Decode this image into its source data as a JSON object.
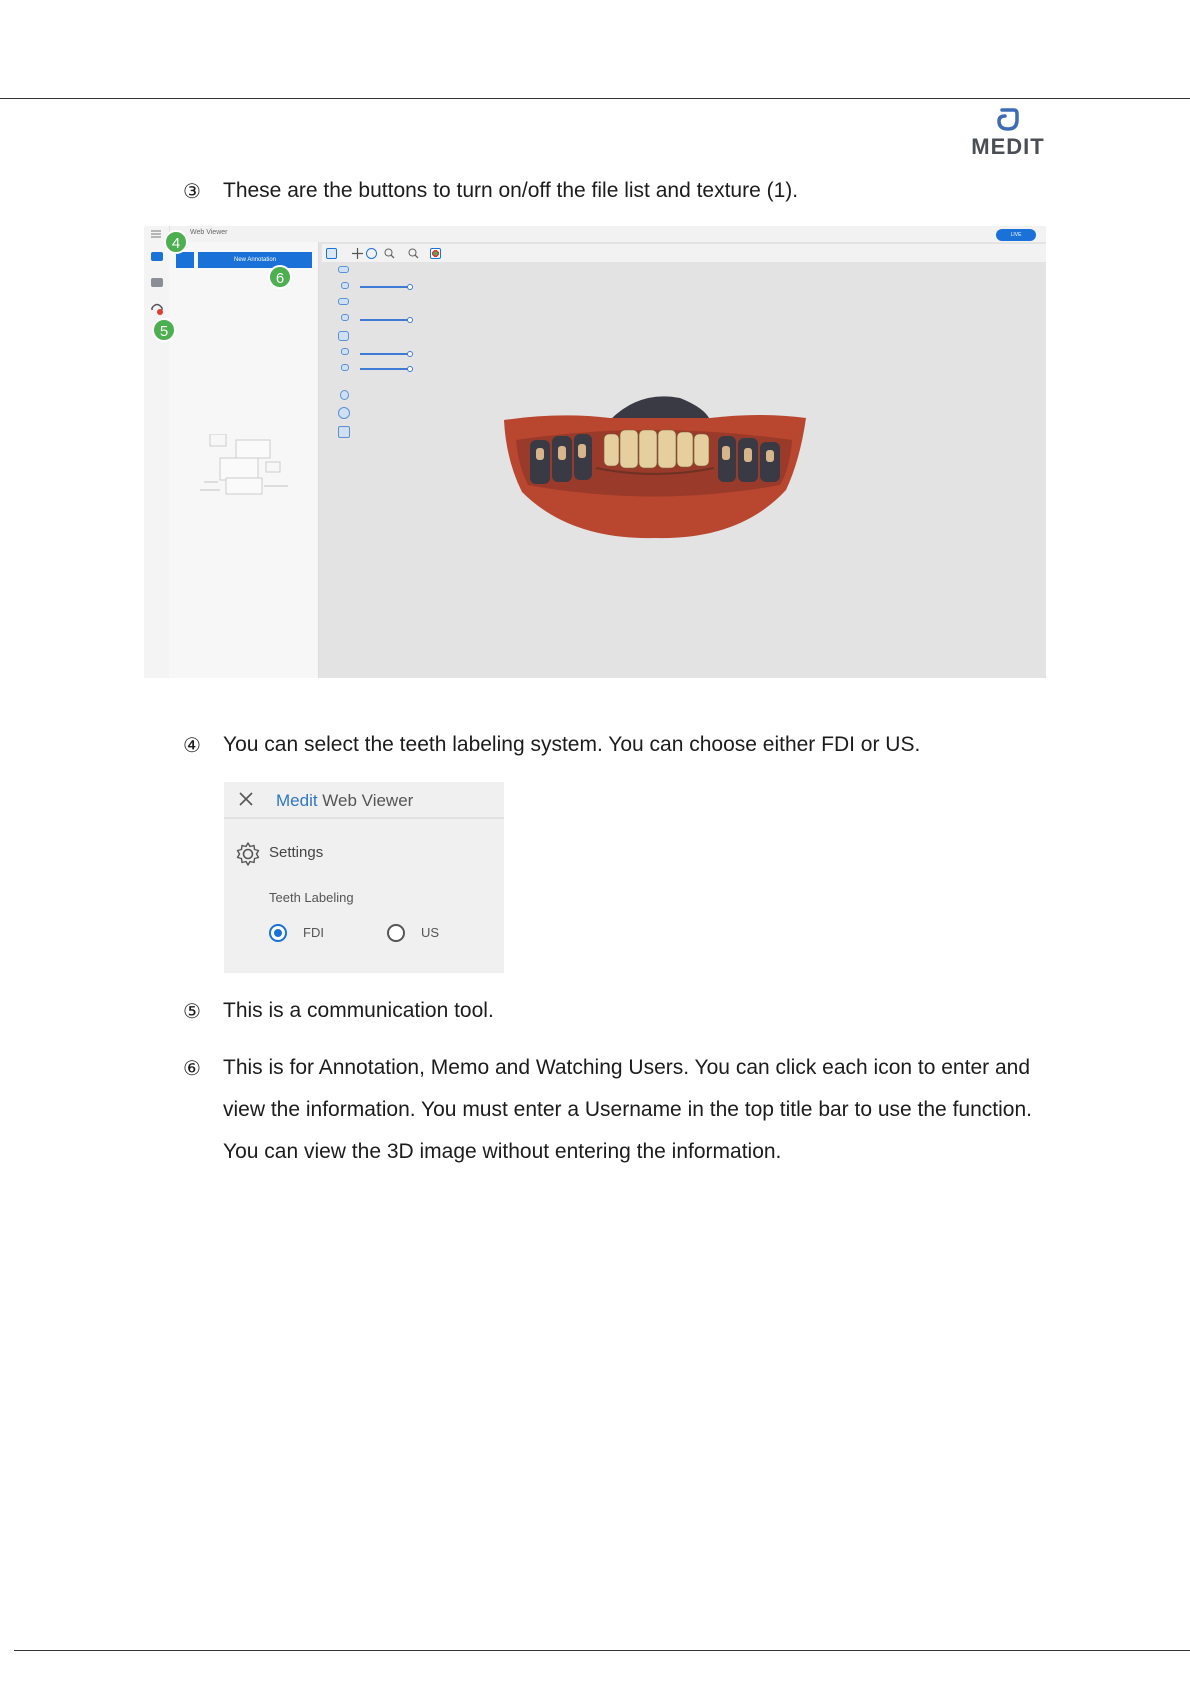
{
  "header": {
    "logo_text": "MEDIT"
  },
  "items": [
    {
      "num": "③",
      "text": "These are the buttons to turn on/off the file list and texture (1)."
    },
    {
      "num": "④",
      "text": "You can select the teeth labeling system. You can choose either FDI or US."
    },
    {
      "num": "⑤",
      "text": "This is a communication tool."
    },
    {
      "num": "⑥",
      "lines": [
        "This is for Annotation, Memo and Watching Users. You can click each icon to enter and",
        "view the information. You must enter a Username in the top title bar to use the function.",
        "You can view the 3D image without entering the information."
      ]
    }
  ],
  "screenshot1": {
    "app_title": "Web Viewer",
    "new_annotation_label": "New Annotation",
    "live_label": "LIVE",
    "badges": [
      "4",
      "6",
      "5"
    ]
  },
  "screenshot2": {
    "title_part1": "Medit",
    "title_part2": " Web Viewer",
    "settings_label": "Settings",
    "teeth_labeling_label": "Teeth Labeling",
    "options": [
      "FDI",
      "US"
    ],
    "selected": "FDI"
  },
  "colors": {
    "accent": "#1a72d9",
    "badge": "#4caf50",
    "title_blue": "#2f76c4"
  }
}
